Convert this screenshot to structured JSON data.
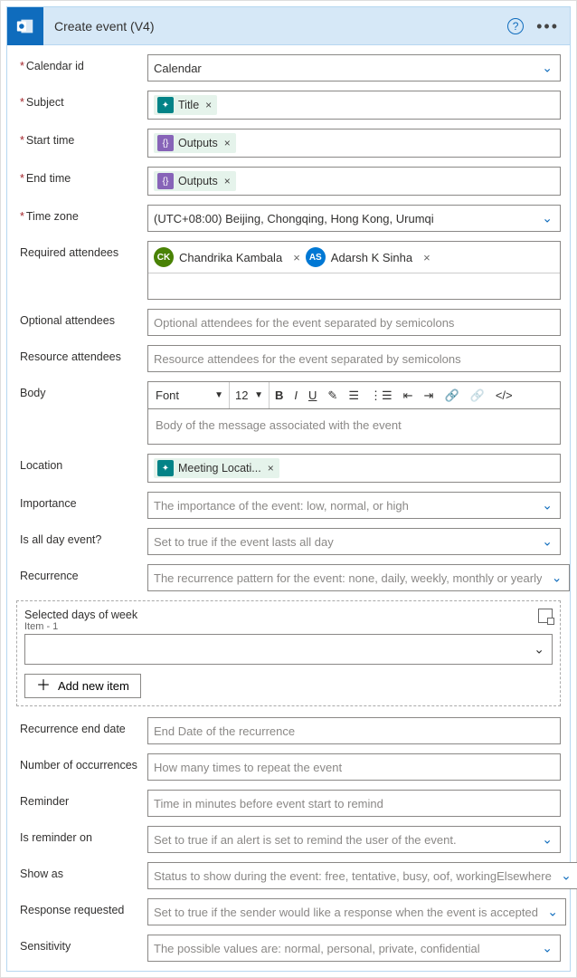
{
  "header": {
    "title": "Create event (V4)"
  },
  "fields": {
    "calendar_id": {
      "label": "Calendar id",
      "value": "Calendar"
    },
    "subject": {
      "label": "Subject",
      "token": "Title"
    },
    "start_time": {
      "label": "Start time",
      "token": "Outputs"
    },
    "end_time": {
      "label": "End time",
      "token": "Outputs"
    },
    "time_zone": {
      "label": "Time zone",
      "value": "(UTC+08:00) Beijing, Chongqing, Hong Kong, Urumqi"
    },
    "required_attendees": {
      "label": "Required attendees",
      "people": [
        {
          "initials": "CK",
          "name": "Chandrika Kambala",
          "avatar_color": "green"
        },
        {
          "initials": "AS",
          "name": "Adarsh K Sinha",
          "avatar_color": "blue"
        }
      ]
    },
    "optional_attendees": {
      "label": "Optional attendees",
      "placeholder": "Optional attendees for the event separated by semicolons"
    },
    "resource_attendees": {
      "label": "Resource attendees",
      "placeholder": "Resource attendees for the event separated by semicolons"
    },
    "body": {
      "label": "Body",
      "font": "Font",
      "size": "12",
      "placeholder": "Body of the message associated with the event"
    },
    "location": {
      "label": "Location",
      "token": "Meeting Locati..."
    },
    "importance": {
      "label": "Importance",
      "placeholder": "The importance of the event: low, normal, or high"
    },
    "is_all_day": {
      "label": "Is all day event?",
      "placeholder": "Set to true if the event lasts all day"
    },
    "recurrence": {
      "label": "Recurrence",
      "placeholder": "The recurrence pattern for the event: none, daily, weekly, monthly or yearly"
    },
    "selected_days": {
      "label": "Selected days of week",
      "sublabel": "Item - 1",
      "add_button": "Add new item"
    },
    "recurrence_end": {
      "label": "Recurrence end date",
      "placeholder": "End Date of the recurrence"
    },
    "num_occurrences": {
      "label": "Number of occurrences",
      "placeholder": "How many times to repeat the event"
    },
    "reminder": {
      "label": "Reminder",
      "placeholder": "Time in minutes before event start to remind"
    },
    "is_reminder_on": {
      "label": "Is reminder on",
      "placeholder": "Set to true if an alert is set to remind the user of the event."
    },
    "show_as": {
      "label": "Show as",
      "placeholder": "Status to show during the event: free, tentative, busy, oof, workingElsewhere"
    },
    "response_requested": {
      "label": "Response requested",
      "placeholder": "Set to true if the sender would like a response when the event is accepted"
    },
    "sensitivity": {
      "label": "Sensitivity",
      "placeholder": "The possible values are: normal, personal, private, confidential"
    }
  }
}
